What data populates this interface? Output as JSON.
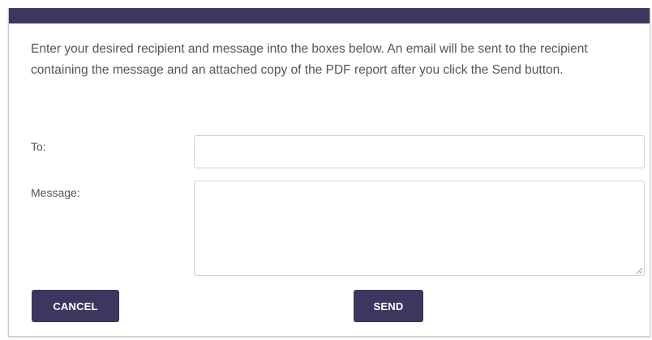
{
  "dialog": {
    "header_color": "#3f3660",
    "instructions": "Enter your desired recipient and message into the boxes below. An email will be sent to the recipient containing the message and an attached copy of the PDF report after you click the Send button."
  },
  "form": {
    "to_label": "To:",
    "to_value": "",
    "message_label": "Message:",
    "message_value": ""
  },
  "buttons": {
    "cancel_label": "CANCEL",
    "send_label": "SEND",
    "color": "#3f3660"
  },
  "icons": {
    "resize_grip": "resize-grip-icon"
  }
}
